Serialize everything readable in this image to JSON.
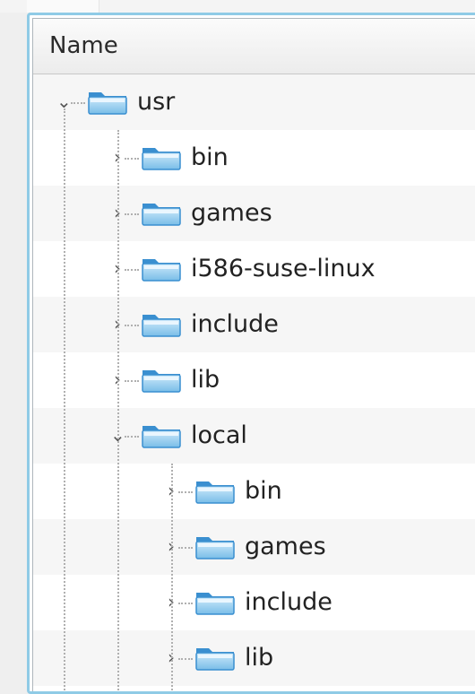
{
  "header": {
    "name_label": "Name"
  },
  "tree": [
    {
      "label": "usr",
      "depth": 0,
      "expanded": true
    },
    {
      "label": "bin",
      "depth": 1,
      "expanded": false
    },
    {
      "label": "games",
      "depth": 1,
      "expanded": false
    },
    {
      "label": "i586-suse-linux",
      "depth": 1,
      "expanded": false
    },
    {
      "label": "include",
      "depth": 1,
      "expanded": false
    },
    {
      "label": "lib",
      "depth": 1,
      "expanded": false
    },
    {
      "label": "local",
      "depth": 1,
      "expanded": true
    },
    {
      "label": "bin",
      "depth": 2,
      "expanded": false
    },
    {
      "label": "games",
      "depth": 2,
      "expanded": false
    },
    {
      "label": "include",
      "depth": 2,
      "expanded": false
    },
    {
      "label": "lib",
      "depth": 2,
      "expanded": false
    }
  ],
  "colors": {
    "frame": "#8fcbe6",
    "folder_light": "#cfeafb",
    "folder_dark": "#3a8fd0"
  }
}
